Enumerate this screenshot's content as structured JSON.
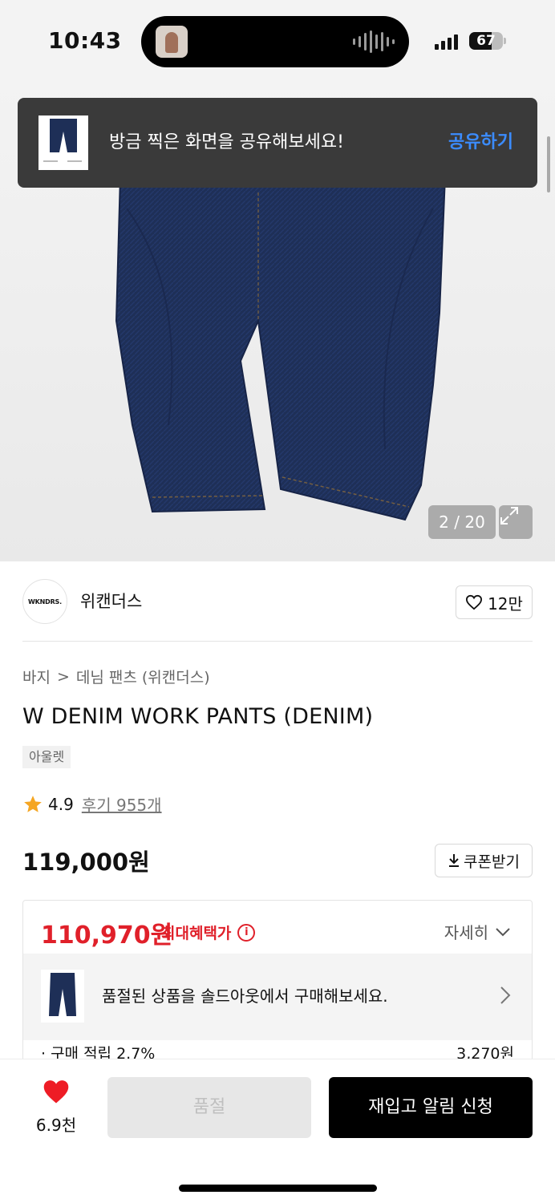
{
  "status_bar": {
    "time": "10:43",
    "battery": "67",
    "battery_level": 0.67,
    "icons": [
      "screenshot-thumbnail-icon",
      "audio-waveform-icon",
      "cellular-signal-icon",
      "battery-icon"
    ]
  },
  "toast": {
    "message": "방금 찍은 화면을 공유해보세요!",
    "action": "공유하기"
  },
  "gallery": {
    "counter": "2 / 20",
    "expand_icon": "expand-icon"
  },
  "brand": {
    "logo_text": "WKNDRS.",
    "name": "위캔더스",
    "likes": "12만"
  },
  "breadcrumb": {
    "category": "바지",
    "separator": ">",
    "subcategory": "데님 팬츠 (위캔더스)"
  },
  "product": {
    "title": "W DENIM WORK PANTS (DENIM)",
    "tag": "아울렛",
    "rating": "4.9",
    "reviews": "후기 955개",
    "price": "119,000원",
    "coupon_label": "쿠폰받기"
  },
  "benefit": {
    "sale_price": "110,970원",
    "max_benefit_label": "최대혜택가",
    "detail_label": "자세히",
    "soldout_message": "품절된 상품을 솔드아웃에서 구매해보세요.",
    "points_label": "· 구매 적립 2.7%",
    "points_value": "3,270원"
  },
  "bottom_bar": {
    "wish_count": "6.9천",
    "soldout_label": "품절",
    "restock_label": "재입고 알림 신청"
  },
  "colors": {
    "sale_red": "#e0202a",
    "action_blue": "#3b8cff",
    "heart_red": "#ee1c25",
    "denim": "#1e2f57"
  }
}
